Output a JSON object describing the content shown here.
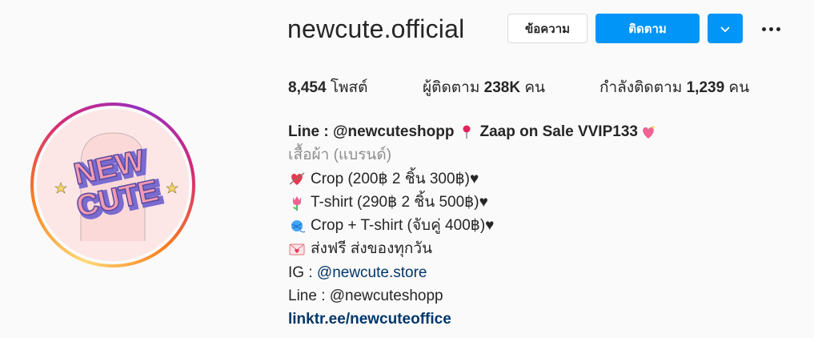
{
  "profile": {
    "username": "newcute.official",
    "message_button": "ข้อความ",
    "follow_button": "ติดตาม",
    "dropdown_icon": "chevron-down-icon",
    "more_icon": "more-options-icon",
    "avatar_text_line1": "NEW",
    "avatar_text_line2": "CUTE"
  },
  "stats": {
    "posts_count": "8,454",
    "posts_label": " โพสต์",
    "followers_label": "ผู้ติดตาม ",
    "followers_count": "238K",
    "followers_unit": " คน",
    "following_label": "กำลังติดตาม ",
    "following_count": "1,239",
    "following_unit": " คน"
  },
  "bio": {
    "name_part1": "Line : @newcuteshopp",
    "name_part2": "Zaap on Sale VVIP133",
    "category": "เสื้อผ้า (แบรนด์)",
    "line1": "Crop (200฿ 2 ชิ้น 300฿)♥",
    "line2": "T-shirt (290฿ 2 ชิ้น 500฿)♥",
    "line3": "Crop + T-shirt (จับคู่ 400฿)♥",
    "line4": "ส่งฟรี ส่งของทุกวัน",
    "ig_prefix": "IG : ",
    "ig_handle": "@newcute.store",
    "line_contact": "Line : @newcuteshopp",
    "link": "linktr.ee/newcuteoffice"
  },
  "colors": {
    "primary_blue": "#0095f6",
    "link_blue": "#00376b",
    "muted": "#8e8e8e"
  }
}
